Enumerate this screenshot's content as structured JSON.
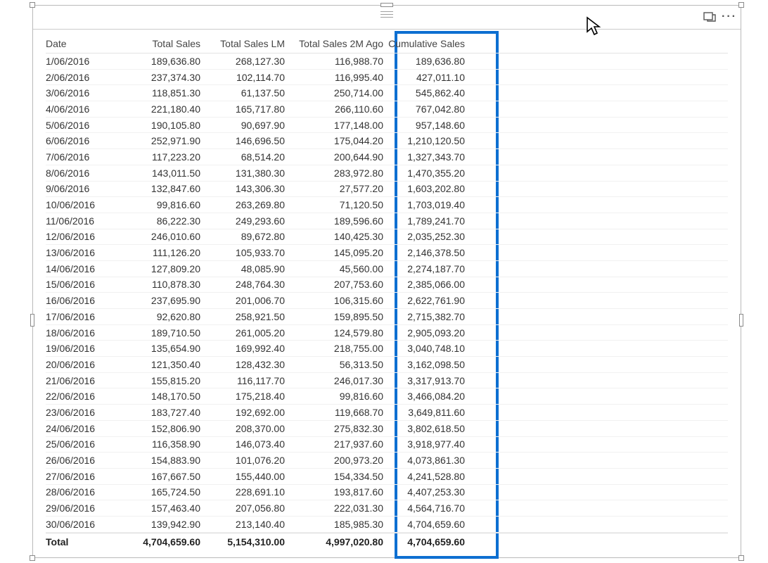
{
  "columns": {
    "date": "Date",
    "total_sales": "Total Sales",
    "total_sales_lm": "Total Sales LM",
    "total_sales_2m": "Total Sales 2M Ago",
    "cumulative": "Cumulative Sales"
  },
  "totals": {
    "label": "Total",
    "total_sales": "4,704,659.60",
    "total_sales_lm": "5,154,310.00",
    "total_sales_2m": "4,997,020.80",
    "cumulative": "4,704,659.60"
  },
  "rows": [
    {
      "date": "1/06/2016",
      "ts": "189,636.80",
      "lm": "268,127.30",
      "m2": "116,988.70",
      "cum": "189,636.80"
    },
    {
      "date": "2/06/2016",
      "ts": "237,374.30",
      "lm": "102,114.70",
      "m2": "116,995.40",
      "cum": "427,011.10"
    },
    {
      "date": "3/06/2016",
      "ts": "118,851.30",
      "lm": "61,137.50",
      "m2": "250,714.00",
      "cum": "545,862.40"
    },
    {
      "date": "4/06/2016",
      "ts": "221,180.40",
      "lm": "165,717.80",
      "m2": "266,110.60",
      "cum": "767,042.80"
    },
    {
      "date": "5/06/2016",
      "ts": "190,105.80",
      "lm": "90,697.90",
      "m2": "177,148.00",
      "cum": "957,148.60"
    },
    {
      "date": "6/06/2016",
      "ts": "252,971.90",
      "lm": "146,696.50",
      "m2": "175,044.20",
      "cum": "1,210,120.50"
    },
    {
      "date": "7/06/2016",
      "ts": "117,223.20",
      "lm": "68,514.20",
      "m2": "200,644.90",
      "cum": "1,327,343.70"
    },
    {
      "date": "8/06/2016",
      "ts": "143,011.50",
      "lm": "131,380.30",
      "m2": "283,972.80",
      "cum": "1,470,355.20"
    },
    {
      "date": "9/06/2016",
      "ts": "132,847.60",
      "lm": "143,306.30",
      "m2": "27,577.20",
      "cum": "1,603,202.80"
    },
    {
      "date": "10/06/2016",
      "ts": "99,816.60",
      "lm": "263,269.80",
      "m2": "71,120.50",
      "cum": "1,703,019.40"
    },
    {
      "date": "11/06/2016",
      "ts": "86,222.30",
      "lm": "249,293.60",
      "m2": "189,596.60",
      "cum": "1,789,241.70"
    },
    {
      "date": "12/06/2016",
      "ts": "246,010.60",
      "lm": "89,672.80",
      "m2": "140,425.30",
      "cum": "2,035,252.30"
    },
    {
      "date": "13/06/2016",
      "ts": "111,126.20",
      "lm": "105,933.70",
      "m2": "145,095.20",
      "cum": "2,146,378.50"
    },
    {
      "date": "14/06/2016",
      "ts": "127,809.20",
      "lm": "48,085.90",
      "m2": "45,560.00",
      "cum": "2,274,187.70"
    },
    {
      "date": "15/06/2016",
      "ts": "110,878.30",
      "lm": "248,764.30",
      "m2": "207,753.60",
      "cum": "2,385,066.00"
    },
    {
      "date": "16/06/2016",
      "ts": "237,695.90",
      "lm": "201,006.70",
      "m2": "106,315.60",
      "cum": "2,622,761.90"
    },
    {
      "date": "17/06/2016",
      "ts": "92,620.80",
      "lm": "258,921.50",
      "m2": "159,895.50",
      "cum": "2,715,382.70"
    },
    {
      "date": "18/06/2016",
      "ts": "189,710.50",
      "lm": "261,005.20",
      "m2": "124,579.80",
      "cum": "2,905,093.20"
    },
    {
      "date": "19/06/2016",
      "ts": "135,654.90",
      "lm": "169,992.40",
      "m2": "218,755.00",
      "cum": "3,040,748.10"
    },
    {
      "date": "20/06/2016",
      "ts": "121,350.40",
      "lm": "128,432.30",
      "m2": "56,313.50",
      "cum": "3,162,098.50"
    },
    {
      "date": "21/06/2016",
      "ts": "155,815.20",
      "lm": "116,117.70",
      "m2": "246,017.30",
      "cum": "3,317,913.70"
    },
    {
      "date": "22/06/2016",
      "ts": "148,170.50",
      "lm": "175,218.40",
      "m2": "99,816.60",
      "cum": "3,466,084.20"
    },
    {
      "date": "23/06/2016",
      "ts": "183,727.40",
      "lm": "192,692.00",
      "m2": "119,668.70",
      "cum": "3,649,811.60"
    },
    {
      "date": "24/06/2016",
      "ts": "152,806.90",
      "lm": "208,370.00",
      "m2": "275,832.30",
      "cum": "3,802,618.50"
    },
    {
      "date": "25/06/2016",
      "ts": "116,358.90",
      "lm": "146,073.40",
      "m2": "217,937.60",
      "cum": "3,918,977.40"
    },
    {
      "date": "26/06/2016",
      "ts": "154,883.90",
      "lm": "101,076.20",
      "m2": "200,973.20",
      "cum": "4,073,861.30"
    },
    {
      "date": "27/06/2016",
      "ts": "167,667.50",
      "lm": "155,440.00",
      "m2": "154,334.50",
      "cum": "4,241,528.80"
    },
    {
      "date": "28/06/2016",
      "ts": "165,724.50",
      "lm": "228,691.10",
      "m2": "193,817.60",
      "cum": "4,407,253.30"
    },
    {
      "date": "29/06/2016",
      "ts": "157,463.40",
      "lm": "207,056.80",
      "m2": "222,031.30",
      "cum": "4,564,716.70"
    },
    {
      "date": "30/06/2016",
      "ts": "139,942.90",
      "lm": "213,140.40",
      "m2": "185,985.30",
      "cum": "4,704,659.60"
    }
  ]
}
